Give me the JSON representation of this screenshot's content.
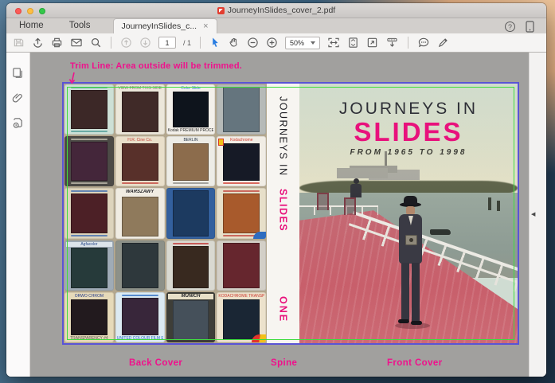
{
  "window": {
    "title": "JourneyInSlides_cover_2.pdf"
  },
  "tabs": {
    "home": "Home",
    "tools": "Tools",
    "document": "JourneyInSlides_c...",
    "close_glyph": "×",
    "help_glyph": "?"
  },
  "toolbar": {
    "page_current": "1",
    "page_total": "/ 1",
    "zoom_level": "50%",
    "icons": [
      "save",
      "share-upload",
      "print",
      "email",
      "search",
      "page-up",
      "page-down",
      "select-arrow",
      "hand-tool",
      "zoom-out",
      "zoom-in",
      "fit-width",
      "fit-page",
      "fullscreen",
      "presentation",
      "comment",
      "pencil"
    ]
  },
  "right_panel": {
    "collapse_glyph": "◀"
  },
  "document": {
    "annotation": "Trim Line: Area outside will be trimmed.",
    "section_labels": {
      "back": "Back Cover",
      "spine": "Spine",
      "front": "Front Cover"
    },
    "front_cover": {
      "title_line1": "JOURNEYS IN",
      "title_line2": "SLIDES",
      "subtitle": "FROM 1965 TO 1998"
    },
    "spine": {
      "title_part1": "JOURNEYS IN",
      "title_part2": "SLIDES",
      "volume": "ONE"
    },
    "colors": {
      "annotation_pink": "#f0108c",
      "accent_magenta": "#e8117c",
      "trim_green": "#3fdc3f",
      "bleed_purple": "#5a54d6"
    },
    "back_cover": {
      "slides": [
        {
          "frame": "#cde0d6",
          "img": "#3c2827",
          "mt": "#4a9a94",
          "mb": "#4a9a94"
        },
        {
          "frame": "#ece7da",
          "img": "#402a28",
          "top": "VIEW FROM THIS SIDE",
          "top_color": "#8a8274"
        },
        {
          "frame": "#f3f0ea",
          "img": "#0e141c",
          "top": "Color Slide",
          "top_color": "#3d85d8",
          "bottom": "Kodak PREMIUM PROCESSING",
          "bottom_color": "#2a2a2a"
        },
        {
          "frame": "#b6bab8",
          "img": "#65757e"
        },
        {
          "frame": "#4c4a46",
          "img": "#44263a",
          "mt": "#c8c4b4",
          "mb": "#c8c4b4"
        },
        {
          "frame": "#e9dfca",
          "img": "#58302a",
          "top": "H.R. Cine Co.",
          "top_color": "#c24038",
          "mb": "#c24038"
        },
        {
          "frame": "#edece6",
          "img": "#8c6c4c",
          "top": "BERLIN",
          "top_color": "#28364a",
          "mb": "#8a8a84"
        },
        {
          "frame": "#f1ede5",
          "img": "#161a26",
          "top": "Kodachrome",
          "top_color": "#d23c30",
          "accent": "y",
          "mb": "#d23c30"
        },
        {
          "frame": "#ddd4bc",
          "img": "#4c2026",
          "mt": "#3a6ab0",
          "mb": "#3a6ab0"
        },
        {
          "frame": "#f0ece2",
          "img": "#8f7a5c",
          "top": "WARSZAWY",
          "top_color": "#26262a",
          "hand": true
        },
        {
          "frame": "#33609e",
          "img": "#1c3a60"
        },
        {
          "frame": "#e7dfc9",
          "img": "#a85a2c",
          "mt": "#c24038",
          "mb": "#c24038",
          "accent": "b"
        },
        {
          "frame": "#9fabb6",
          "img": "#263a3a",
          "top": "Agfacolor",
          "top_color": "#2a4a8a",
          "label_bg": "#dce4ea"
        },
        {
          "frame": "#8d9189",
          "img": "#2e383c"
        },
        {
          "frame": "#d9d9d1",
          "img": "#38291f",
          "mt": "#c03030"
        },
        {
          "frame": "#d3cfc7",
          "img": "#66262e"
        },
        {
          "frame": "#e6dab9",
          "img": "#221a1e",
          "top": "ORWO CHROM",
          "top_color": "#223a8a",
          "bottom": "TRANSPARENCY #4",
          "bottom_color": "#55554a"
        },
        {
          "frame": "#dceaf2",
          "img": "#38263a",
          "mt": "#2a6ac0",
          "bottom": "UNITED COLOUR FILM EST.",
          "bottom_color": "#2a6ac0"
        },
        {
          "frame": "#3e3e38",
          "img": "#45505a",
          "top": "MUNICH",
          "top_color": "#26262a",
          "label_bg": "#e8e0c8",
          "hand": true
        },
        {
          "frame": "#ece2cc",
          "img": "#1a2634",
          "top": "KODACHROME TRANSPARENCY",
          "top_color": "#cc3a30",
          "accent": "r"
        }
      ]
    }
  }
}
